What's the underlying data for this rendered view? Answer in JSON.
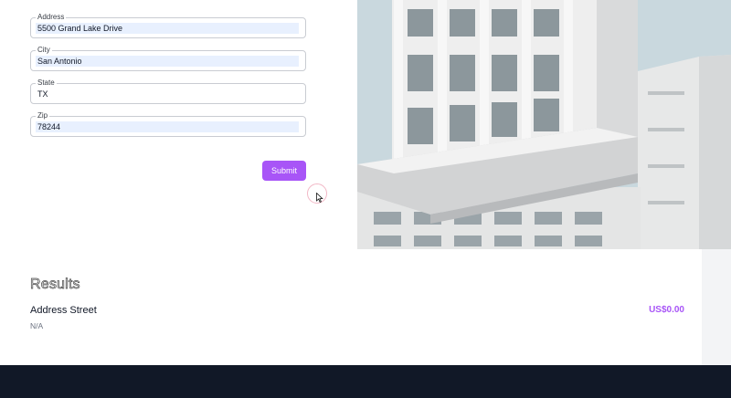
{
  "form": {
    "address": {
      "label": "Address",
      "value": "5500 Grand Lake Drive"
    },
    "city": {
      "label": "City",
      "value": "San Antonio"
    },
    "state": {
      "label": "State",
      "value": "TX"
    },
    "zip": {
      "label": "Zip",
      "value": "78244"
    },
    "submit_label": "Submit"
  },
  "results": {
    "title": "Results",
    "item": {
      "name": "Address Street",
      "sub": "N/A",
      "price": "US$0.00"
    }
  },
  "colors": {
    "accent": "#a855f7",
    "footer": "#111827",
    "autofill": "#e8f0fe"
  },
  "icons": {
    "cursor": "cursor-arrow-icon"
  }
}
